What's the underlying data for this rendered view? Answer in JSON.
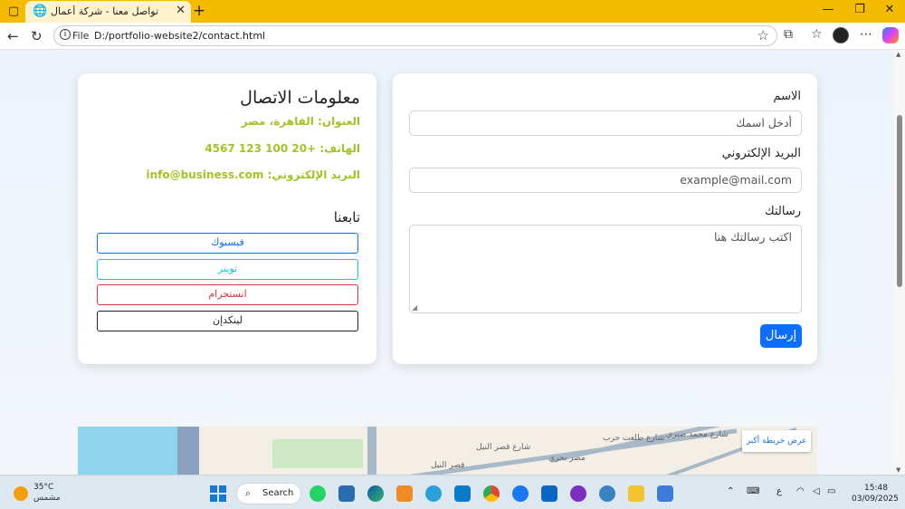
{
  "browser": {
    "tab_title": "تواصل معنا - شركة أعمال",
    "url_scheme": "File",
    "url_path": "D:/portfolio-website2/contact.html"
  },
  "form": {
    "name_label": "الاسم",
    "name_placeholder": "أدخل اسمك",
    "email_label": "البريد الإلكتروني",
    "email_placeholder": "example@mail.com",
    "message_label": "رسالتك",
    "message_placeholder": "اكتب رسالتك هنا",
    "submit_label": "إرسال"
  },
  "info": {
    "title": "معلومات الاتصال",
    "address": "العنوان: القاهرة، مصر",
    "phone": "الهاتف: +20 100 123 4567",
    "email": "البريد الإلكتروني: info@business.com",
    "follow_title": "تابعنا",
    "social": [
      {
        "label": "فيسبوك",
        "color": "#0d6efd"
      },
      {
        "label": "تويتر",
        "color": "#0dcaf0"
      },
      {
        "label": "انستجرام",
        "color": "#dc3545"
      },
      {
        "label": "لينكدإن",
        "color": "#212529"
      }
    ]
  },
  "map": {
    "larger_map": "عرض خريطة أكبر",
    "streets": [
      "شارع محمد صبري",
      "شارع قصر النيل",
      "شارع طلعت حرب",
      "قصر النيل",
      "مصر بحري"
    ]
  },
  "taskbar": {
    "temperature": "35°C",
    "condition": "مشمس",
    "search": "Search",
    "time": "15:48",
    "date": "03/09/2025",
    "lang": "ع"
  },
  "colors": {
    "tabbar": "#f5bb00",
    "accent": "#0d6efd",
    "info_text": "#a3c324"
  }
}
